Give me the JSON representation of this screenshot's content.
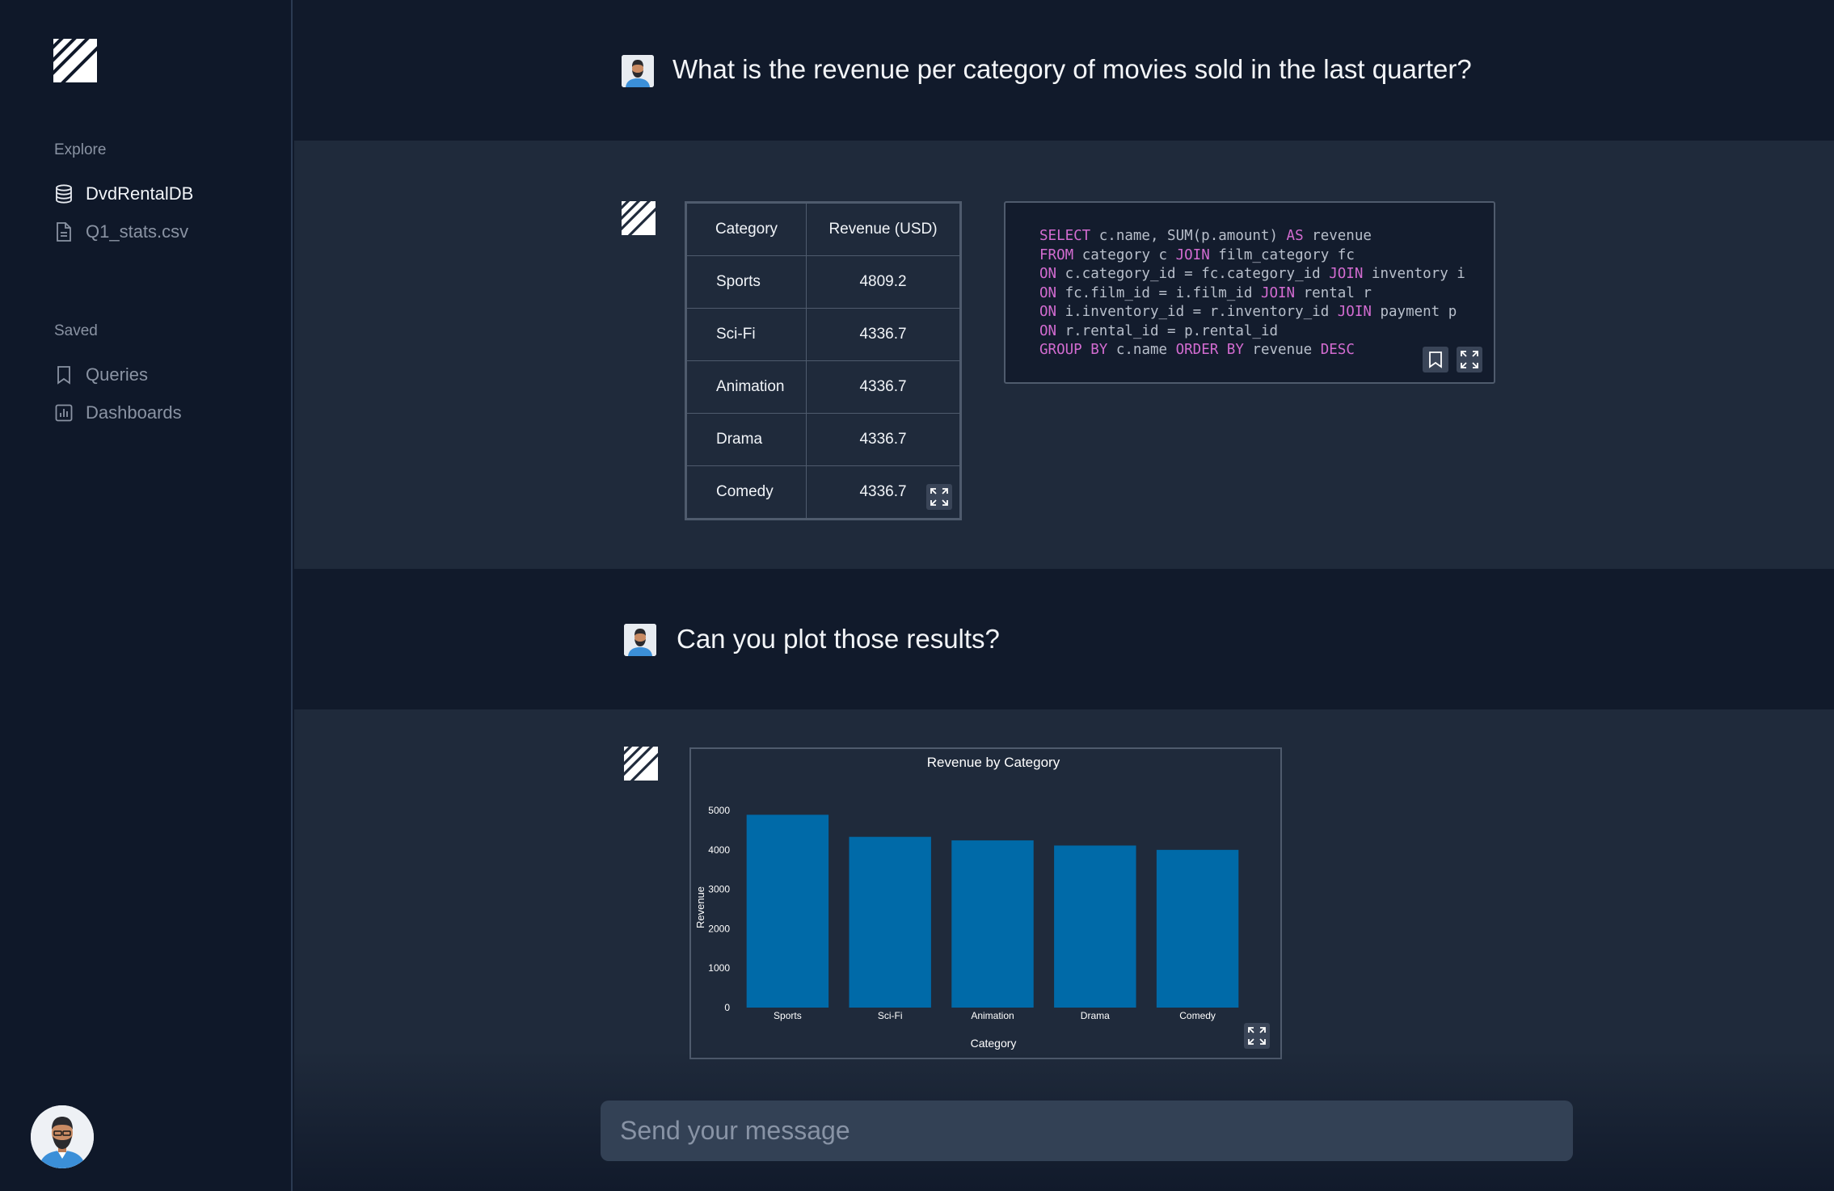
{
  "sidebar": {
    "explore_label": "Explore",
    "explore_items": [
      {
        "label": "DvdRentalDB",
        "icon": "database-icon"
      },
      {
        "label": "Q1_stats.csv",
        "icon": "file-icon"
      }
    ],
    "saved_label": "Saved",
    "saved_items": [
      {
        "label": "Queries",
        "icon": "bookmark-icon"
      },
      {
        "label": "Dashboards",
        "icon": "chart-icon"
      }
    ]
  },
  "conversation": {
    "q1": "What is the revenue per category of movies sold in the last quarter?",
    "table": {
      "headers": [
        "Category",
        "Revenue (USD)"
      ],
      "rows": [
        [
          "Sports",
          "4809.2"
        ],
        [
          "Sci-Fi",
          "4336.7"
        ],
        [
          "Animation",
          "4336.7"
        ],
        [
          "Drama",
          "4336.7"
        ],
        [
          "Comedy",
          "4336.7"
        ]
      ]
    },
    "sql": [
      [
        [
          "kw",
          "SELECT"
        ],
        [
          "t",
          " c.name, SUM(p.amount) "
        ],
        [
          "kw",
          "AS"
        ],
        [
          "t",
          " revenue"
        ]
      ],
      [
        [
          "kw",
          "FROM"
        ],
        [
          "t",
          " category c "
        ],
        [
          "kw",
          "JOIN"
        ],
        [
          "t",
          " film_category fc"
        ]
      ],
      [
        [
          "kw",
          "ON"
        ],
        [
          "t",
          " c.category_id = fc.category_id "
        ],
        [
          "kw",
          "JOIN"
        ],
        [
          "t",
          " inventory i"
        ]
      ],
      [
        [
          "kw",
          "ON"
        ],
        [
          "t",
          " fc.film_id = i.film_id "
        ],
        [
          "kw",
          "JOIN"
        ],
        [
          "t",
          " rental r"
        ]
      ],
      [
        [
          "kw",
          "ON"
        ],
        [
          "t",
          " i.inventory_id = r.inventory_id "
        ],
        [
          "kw",
          "JOIN"
        ],
        [
          "t",
          " payment p"
        ]
      ],
      [
        [
          "kw",
          "ON"
        ],
        [
          "t",
          " r.rental_id = p.rental_id"
        ]
      ],
      [
        [
          "kw",
          "GROUP BY"
        ],
        [
          "t",
          " c.name "
        ],
        [
          "kw",
          "ORDER BY"
        ],
        [
          "t",
          " revenue "
        ],
        [
          "kw",
          "DESC"
        ]
      ]
    ],
    "q2": "Can you plot those results?"
  },
  "chart_data": {
    "type": "bar",
    "title": "Revenue by Category",
    "xlabel": "Category",
    "ylabel": "Revenue",
    "categories": [
      "Sports",
      "Sci-Fi",
      "Animation",
      "Drama",
      "Comedy"
    ],
    "values": [
      4890,
      4330,
      4240,
      4110,
      4000
    ],
    "ylim": [
      0,
      5000
    ],
    "yticks": [
      0,
      1000,
      2000,
      3000,
      4000,
      5000
    ],
    "bar_color": "#006aa8"
  },
  "input": {
    "placeholder": "Send your message"
  },
  "colors": {
    "accent_bar": "#006aa8",
    "keyword": "#d36cd1"
  }
}
